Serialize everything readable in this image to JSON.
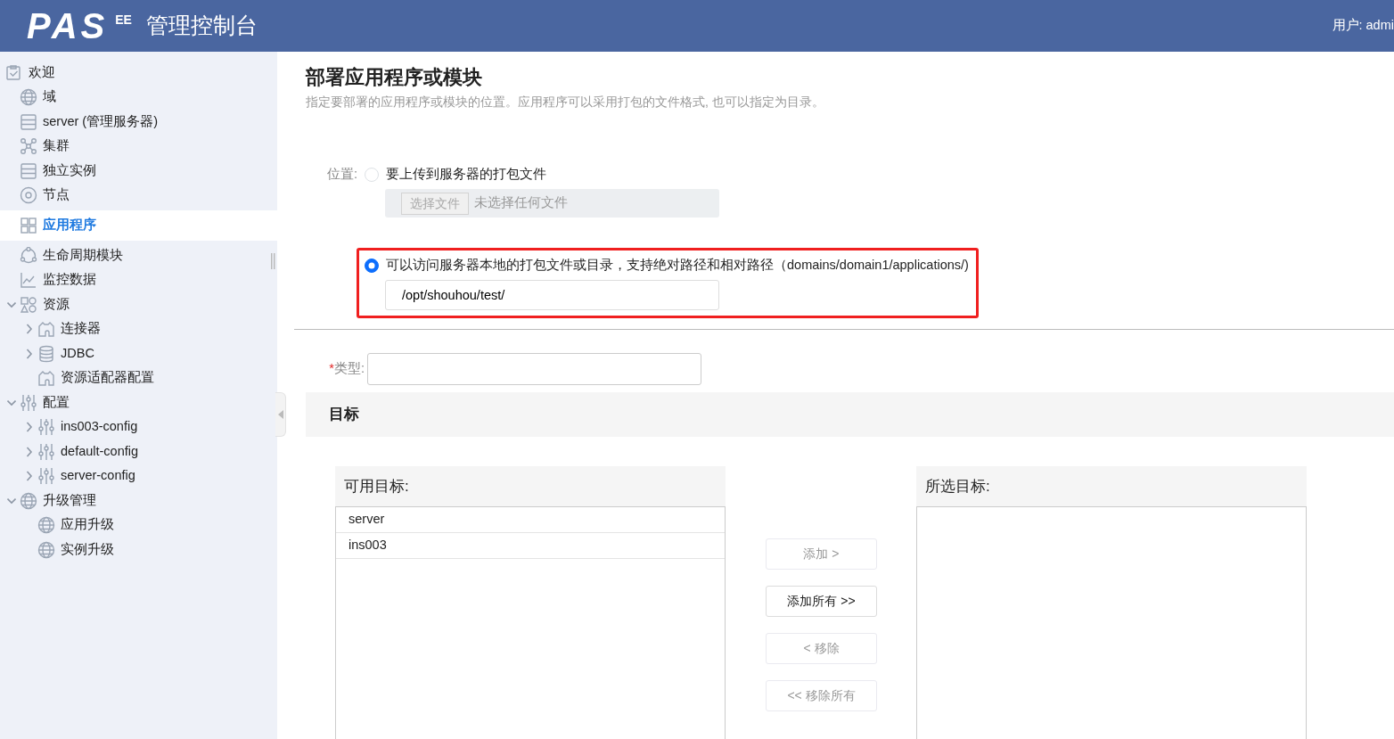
{
  "header": {
    "logo": "PAS",
    "edition": "EE",
    "title": "管理控制台",
    "user": "用户: admi"
  },
  "sidebar": {
    "items": [
      {
        "label": "欢迎",
        "kind": "welcome",
        "selected": false,
        "children": [
          {
            "label": "域",
            "kind": "domain",
            "selected": false
          },
          {
            "label": "server (管理服务器)",
            "kind": "server",
            "selected": false
          },
          {
            "label": "集群",
            "kind": "cluster",
            "selected": false
          },
          {
            "label": "独立实例",
            "kind": "server",
            "selected": false
          },
          {
            "label": "节点",
            "kind": "node",
            "selected": false
          },
          {
            "label": "应用程序",
            "kind": "apps",
            "selected": true
          },
          {
            "label": "生命周期模块",
            "kind": "lifecycle",
            "selected": false
          },
          {
            "label": "监控数据",
            "kind": "monitor",
            "selected": false
          },
          {
            "label": "资源",
            "kind": "resources",
            "selected": false,
            "expanded": true,
            "children": [
              {
                "label": "连接器",
                "kind": "connector",
                "selected": false,
                "expanded": false
              },
              {
                "label": "JDBC",
                "kind": "database",
                "selected": false,
                "expanded": false
              },
              {
                "label": "资源适配器配置",
                "kind": "connector",
                "selected": false
              }
            ]
          },
          {
            "label": "配置",
            "kind": "config",
            "selected": false,
            "expanded": true,
            "children": [
              {
                "label": "ins003-config",
                "kind": "config",
                "selected": false,
                "expanded": false
              },
              {
                "label": "default-config",
                "kind": "config",
                "selected": false,
                "expanded": false
              },
              {
                "label": "server-config",
                "kind": "config",
                "selected": false,
                "expanded": false
              }
            ]
          },
          {
            "label": "升级管理",
            "kind": "domain",
            "selected": false,
            "expanded": true,
            "children": [
              {
                "label": "应用升级",
                "kind": "domain",
                "selected": false
              },
              {
                "label": "实例升级",
                "kind": "domain",
                "selected": false
              }
            ]
          }
        ]
      }
    ]
  },
  "page": {
    "title": "部署应用程序或模块",
    "description": "指定要部署的应用程序或模块的位置。应用程序可以采用打包的文件格式, 也可以指定为目录。"
  },
  "location": {
    "label": "位置:",
    "options": [
      {
        "kind": "upload",
        "label": "要上传到服务器的打包文件",
        "selected": false,
        "button": "选择文件",
        "file_status": "未选择任何文件"
      },
      {
        "kind": "path",
        "label": "可以访问服务器本地的打包文件或目录，支持绝对路径和相对路径（domains/domain1/applications/)",
        "selected": true,
        "value": "/opt/shouhou/test/"
      }
    ]
  },
  "type_field": {
    "label": "类型:",
    "required_mark": "*"
  },
  "targets": {
    "title": "目标",
    "available": {
      "title": "可用目标:",
      "items": [
        "server",
        "ins003"
      ]
    },
    "chosen": {
      "title": "所选目标:"
    },
    "buttons": [
      {
        "label": "添加 >",
        "disabled": true
      },
      {
        "label": "添加所有 >>",
        "disabled": false
      },
      {
        "label": "< 移除",
        "disabled": true
      },
      {
        "label": "<< 移除所有",
        "disabled": true
      }
    ]
  }
}
